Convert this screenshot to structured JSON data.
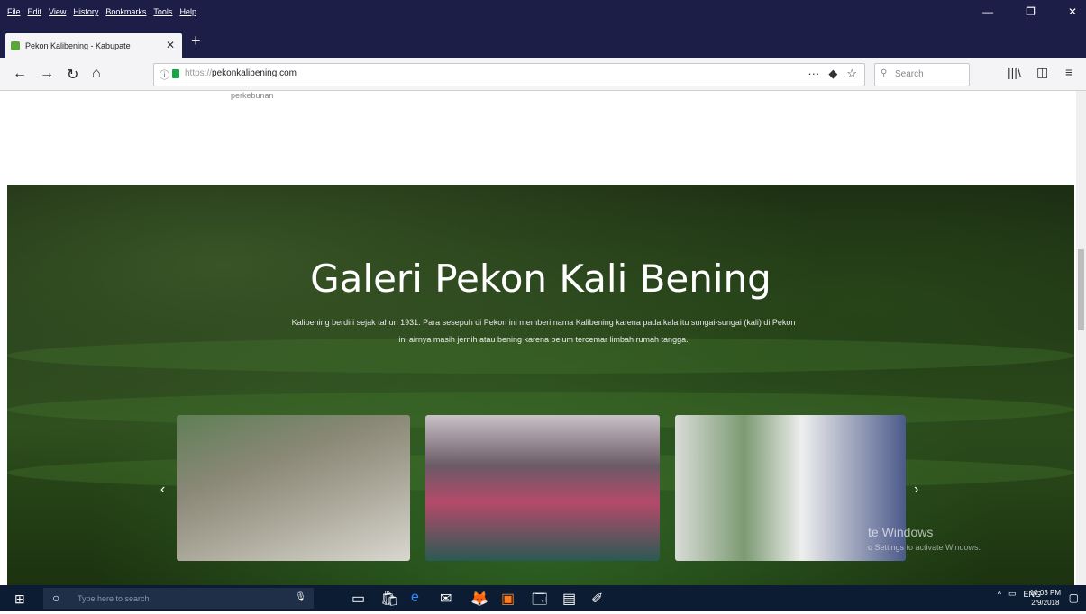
{
  "menubar": {
    "items": [
      "File",
      "Edit",
      "View",
      "History",
      "Bookmarks",
      "Tools",
      "Help"
    ],
    "window_controls": [
      "—",
      "❐",
      "✕"
    ]
  },
  "tab": {
    "title": "Pekon Kalibening - Kabupate",
    "close": "✕",
    "new_tab": "+"
  },
  "nav": {
    "back": "←",
    "forward": "→",
    "reload": "↻",
    "home": "⌂",
    "url_proto": "https://",
    "url_host": "pekonkalibening.com",
    "page_actions": [
      "···",
      "◆",
      "☆"
    ],
    "search_placeholder": "Search",
    "library": "|||\\",
    "sidebar": "◫",
    "menu": "≡"
  },
  "page": {
    "prev_text_1": "perkebunan",
    "prev_text_2": "",
    "prev_text_3": "",
    "hero_title": "Galeri Pekon Kali Bening",
    "hero_desc": "Kalibening berdiri sejak tahun 1931. Para sesepuh di Pekon ini memberi nama Kalibening karena pada kala itu sungai-sungai (kali) di Pekon ini airnya masih jernih atau bening karena belum tercemar limbah rumah tangga.",
    "prev_arrow": "‹",
    "next_arrow": "›",
    "watermark_title": "te Windows",
    "watermark_sub": "o Settings to activate Windows."
  },
  "taskbar": {
    "start": "⊞",
    "search_icon": "○",
    "search_placeholder": "Type here to search",
    "mic": "🎙",
    "apps": [
      "▭",
      "🛍",
      "e",
      "✉",
      "🦊",
      "▣",
      "🗔",
      "▤",
      "✐"
    ],
    "tray": [
      "^",
      "▭",
      "ENG"
    ],
    "time": "10:03 PM",
    "date": "2/9/2018",
    "notification": "▢"
  },
  "colors": {
    "titlebar": "#1c1e47",
    "taskbar": "#0c1c33",
    "toolbar": "#f4f4f6"
  }
}
